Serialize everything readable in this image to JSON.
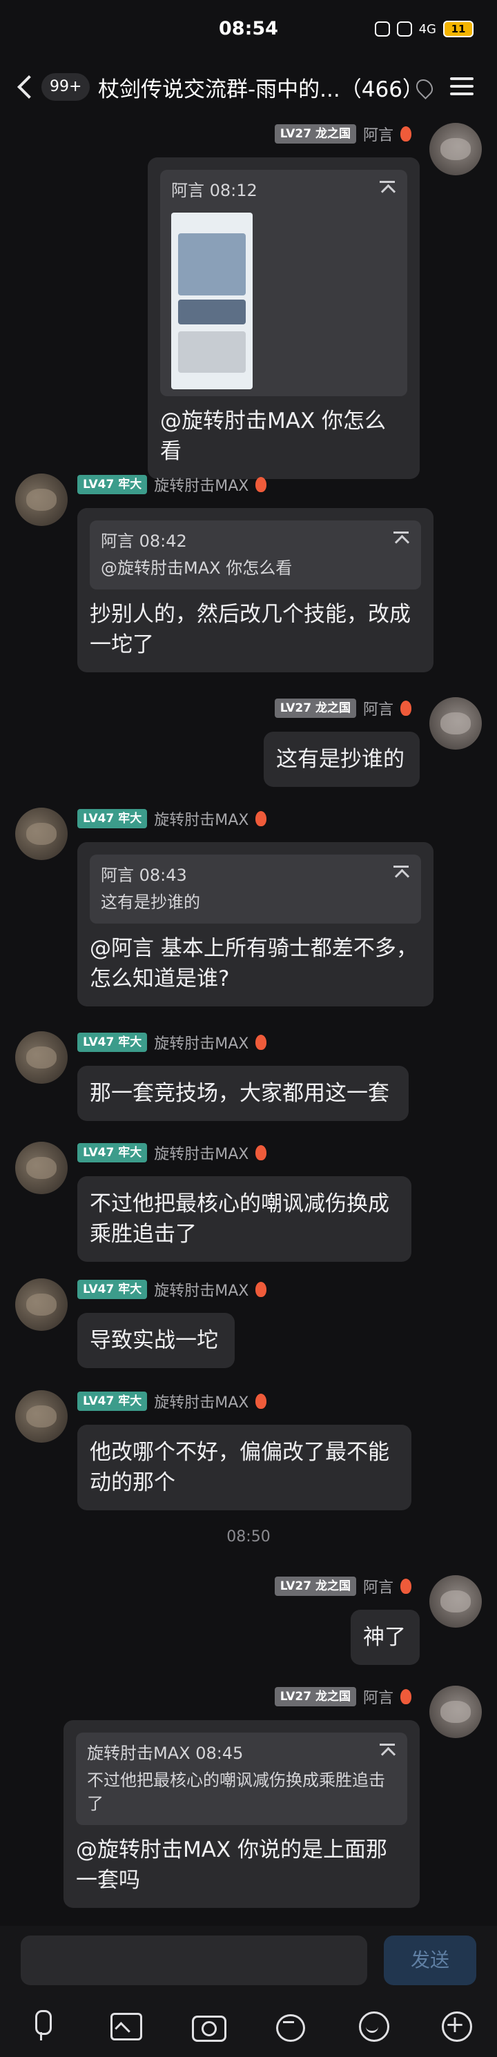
{
  "status_bar": {
    "time": "08:54",
    "battery": "11",
    "network": "4G"
  },
  "header": {
    "unread_count": "99+",
    "title": "杖剑传说交流群-雨中的...（466）"
  },
  "users": {
    "ayan": {
      "name": "阿言",
      "level": "LV27 龙之国"
    },
    "max": {
      "name": "旋转肘击MAX",
      "level": "LV47 牢大"
    }
  },
  "messages": [
    {
      "quote_head": "阿言 08:12",
      "text": "@旋转肘击MAX 你怎么看"
    },
    {
      "quote_head": "阿言 08:42",
      "quote_body": "@旋转肘击MAX 你怎么看",
      "text": "抄别人的，然后改几个技能，改成一坨了"
    },
    {
      "text": "这有是抄谁的"
    },
    {
      "quote_head": "阿言 08:43",
      "quote_body": "这有是抄谁的",
      "text": "@阿言 基本上所有骑士都差不多，怎么知道是谁?"
    },
    {
      "text": "那一套竞技场，大家都用这一套"
    },
    {
      "text": "不过他把最核心的嘲讽减伤换成乘胜追击了"
    },
    {
      "text": "导致实战一坨"
    },
    {
      "text": "他改哪个不好，偏偏改了最不能动的那个"
    },
    {
      "text": "神了"
    },
    {
      "quote_head": "旋转肘击MAX 08:45",
      "quote_body": "不过他把最核心的嘲讽减伤换成乘胜追击了",
      "text": "@旋转肘击MAX 你说的是上面那一套吗"
    }
  ],
  "timestamp_divider": "08:50",
  "composer": {
    "send_label": "发送"
  },
  "colors": {
    "background": "#111113",
    "bubble": "#2b2b2e",
    "quote": "#3b3b3f",
    "badge_teal": "#3c9c8b",
    "badge_gray": "#6c6c70",
    "send": "#21364f"
  },
  "icons": [
    "back-icon",
    "menu-icon",
    "pin-icon",
    "mic-icon",
    "image-icon",
    "camera-icon",
    "sticker-icon",
    "emoji-icon",
    "plus-icon",
    "quote-top-icon",
    "fire-icon"
  ]
}
